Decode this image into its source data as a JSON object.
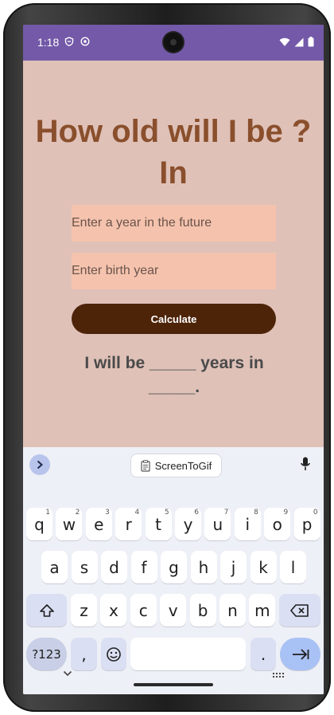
{
  "status_bar": {
    "time": "1:18"
  },
  "app": {
    "title": "How old will I be ? In",
    "future_year_placeholder": "Enter a year in the future",
    "birth_year_placeholder": "Enter birth year",
    "calculate_label": "Calculate",
    "result_text": "I will be _____ years in _____."
  },
  "keyboard": {
    "clipboard_label": "ScreenToGif",
    "row1": [
      {
        "k": "q",
        "h": "1"
      },
      {
        "k": "w",
        "h": "2"
      },
      {
        "k": "e",
        "h": "3"
      },
      {
        "k": "r",
        "h": "4"
      },
      {
        "k": "t",
        "h": "5"
      },
      {
        "k": "y",
        "h": "6"
      },
      {
        "k": "u",
        "h": "7"
      },
      {
        "k": "i",
        "h": "8"
      },
      {
        "k": "o",
        "h": "9"
      },
      {
        "k": "p",
        "h": "0"
      }
    ],
    "row2": [
      "a",
      "s",
      "d",
      "f",
      "g",
      "h",
      "j",
      "k",
      "l"
    ],
    "row3": [
      "z",
      "x",
      "c",
      "v",
      "b",
      "n",
      "m"
    ],
    "symbols_label": "?123",
    "comma_label": ",",
    "period_label": "."
  },
  "colors": {
    "status_bar": "#7359a8",
    "background": "#dfc1b8",
    "title": "#8a4f2c",
    "field": "#f5c3ad",
    "button": "#4e2409"
  }
}
